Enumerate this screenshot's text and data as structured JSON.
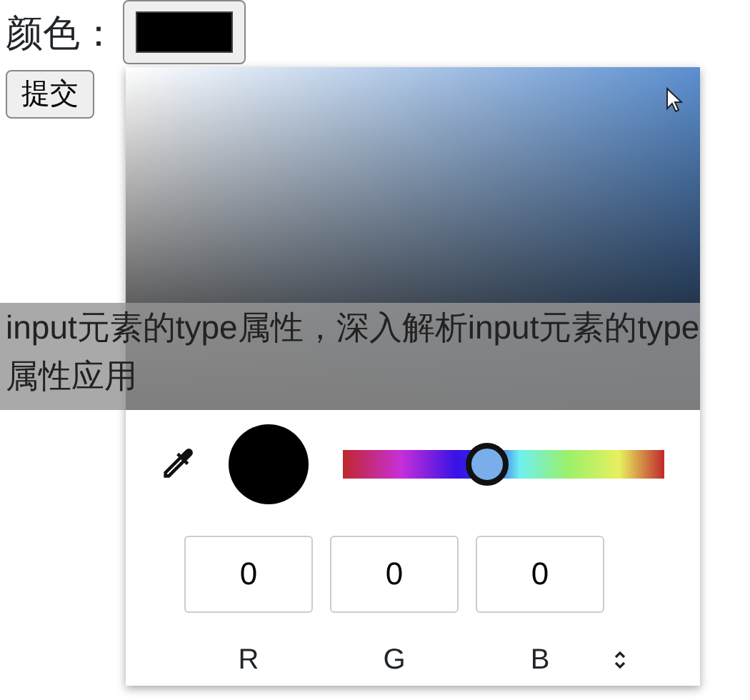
{
  "form": {
    "label": "颜色：",
    "swatch": {
      "color": "#000000"
    },
    "submit": "提交"
  },
  "picker": {
    "preview": {
      "color": "#000000"
    },
    "hue_slider": {
      "level": 0.45
    },
    "channels": [
      {
        "value": "0",
        "label": "R"
      },
      {
        "value": "0",
        "label": "G"
      },
      {
        "value": "0",
        "label": "B"
      }
    ]
  },
  "caption": "input元素的type属性，深入解析input元素的type属性应用"
}
